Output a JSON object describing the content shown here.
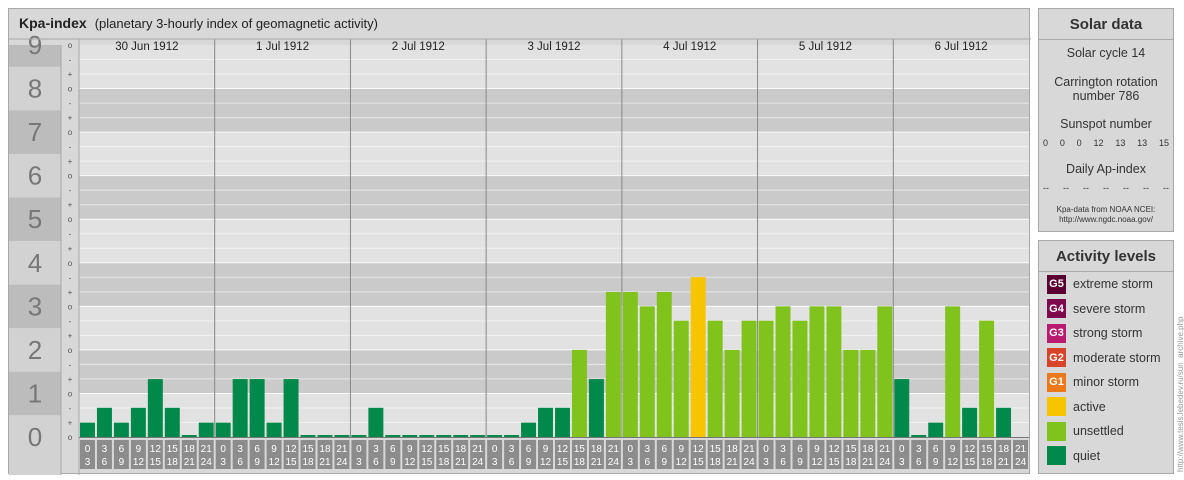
{
  "header": {
    "title": "Kpa-index",
    "subtitle": "(planetary 3-hourly index of geomagnetic activity)"
  },
  "chart_data": {
    "type": "bar",
    "title": "Kpa-index",
    "subtitle": "(planetary 3-hourly index of geomagnetic activity)",
    "ylim": [
      0,
      9
    ],
    "y_ticks": [
      "0",
      "1",
      "2",
      "3",
      "4",
      "5",
      "6",
      "7",
      "8",
      "9"
    ],
    "sub_ticks": [
      "o",
      "+",
      "-",
      "o",
      "+",
      "-",
      "o",
      "+",
      "-",
      "o",
      "+",
      "-",
      "o",
      "+",
      "-",
      "o",
      "+",
      "-",
      "o",
      "+",
      "-",
      "o",
      "+",
      "-",
      "o",
      "+",
      "-",
      "o"
    ],
    "days": [
      "30 Jun 1912",
      "1 Jul 1912",
      "2 Jul 1912",
      "3 Jul 1912",
      "4 Jul 1912",
      "5 Jul 1912",
      "6 Jul 1912"
    ],
    "hour_start": [
      "0",
      "3",
      "6",
      "9",
      "12",
      "15",
      "18",
      "21"
    ],
    "hour_end": [
      "3",
      "6",
      "9",
      "12",
      "15",
      "18",
      "21",
      "24"
    ],
    "values": [
      0.33,
      0.67,
      0.33,
      0.67,
      1.33,
      0.67,
      0,
      0.33,
      0.33,
      1.33,
      1.33,
      0.33,
      1.33,
      0,
      0,
      0,
      0,
      0.67,
      0,
      0,
      0,
      0,
      0,
      0,
      0,
      0,
      0.33,
      0.67,
      0.67,
      2,
      1.33,
      3.33,
      3.33,
      3,
      3.33,
      2.67,
      3.67,
      2.67,
      2,
      2.67,
      2.67,
      3,
      2.67,
      3,
      3,
      2,
      2,
      3,
      1.33,
      0,
      0.33,
      3,
      0.67,
      2.67,
      0.67
    ],
    "levels": [
      "quiet",
      "quiet",
      "quiet",
      "quiet",
      "quiet",
      "quiet",
      "quiet",
      "quiet",
      "quiet",
      "quiet",
      "quiet",
      "quiet",
      "quiet",
      "quiet",
      "quiet",
      "quiet",
      "quiet",
      "quiet",
      "quiet",
      "quiet",
      "quiet",
      "quiet",
      "quiet",
      "quiet",
      "quiet",
      "quiet",
      "quiet",
      "quiet",
      "quiet",
      "unsettled",
      "quiet",
      "unsettled",
      "unsettled",
      "unsettled",
      "unsettled",
      "unsettled",
      "active",
      "unsettled",
      "unsettled",
      "unsettled",
      "unsettled",
      "unsettled",
      "unsettled",
      "unsettled",
      "unsettled",
      "unsettled",
      "unsettled",
      "unsettled",
      "quiet",
      "quiet",
      "quiet",
      "unsettled",
      "quiet",
      "unsettled",
      "quiet"
    ],
    "colors": {
      "quiet": "#00894a",
      "unsettled": "#7fc31c",
      "active": "#f6c500"
    }
  },
  "solar": {
    "title": "Solar data",
    "cycle": "Solar cycle 14",
    "carrington": [
      "Carrington rotation",
      "number 786"
    ],
    "sunspot_label": "Sunspot number",
    "sunspots": [
      "0",
      "0",
      "0",
      "12",
      "13",
      "13",
      "15"
    ],
    "ap_label": "Daily Ap-index",
    "ap_values": [
      "--",
      "--",
      "--",
      "--",
      "--",
      "--",
      "--"
    ],
    "source_lines": [
      "Kpa-data from NOAA NCEI:",
      "http://www.ngdc.noaa.gov/"
    ]
  },
  "levels_panel": {
    "title": "Activity levels",
    "items": [
      {
        "code": "G5",
        "label": "extreme storm",
        "color": "#5a0030"
      },
      {
        "code": "G4",
        "label": "severe storm",
        "color": "#7e0a4e"
      },
      {
        "code": "G3",
        "label": "strong storm",
        "color": "#b71a6e"
      },
      {
        "code": "G2",
        "label": "moderate storm",
        "color": "#d8442a"
      },
      {
        "code": "G1",
        "label": "minor storm",
        "color": "#ec7a1a"
      },
      {
        "code": "",
        "label": "active",
        "color": "#f6c500"
      },
      {
        "code": "",
        "label": "unsettled",
        "color": "#7fc31c"
      },
      {
        "code": "",
        "label": "quiet",
        "color": "#00894a"
      }
    ]
  },
  "credit": "http://www.tesis.lebedev.ru/sun_archive.php"
}
